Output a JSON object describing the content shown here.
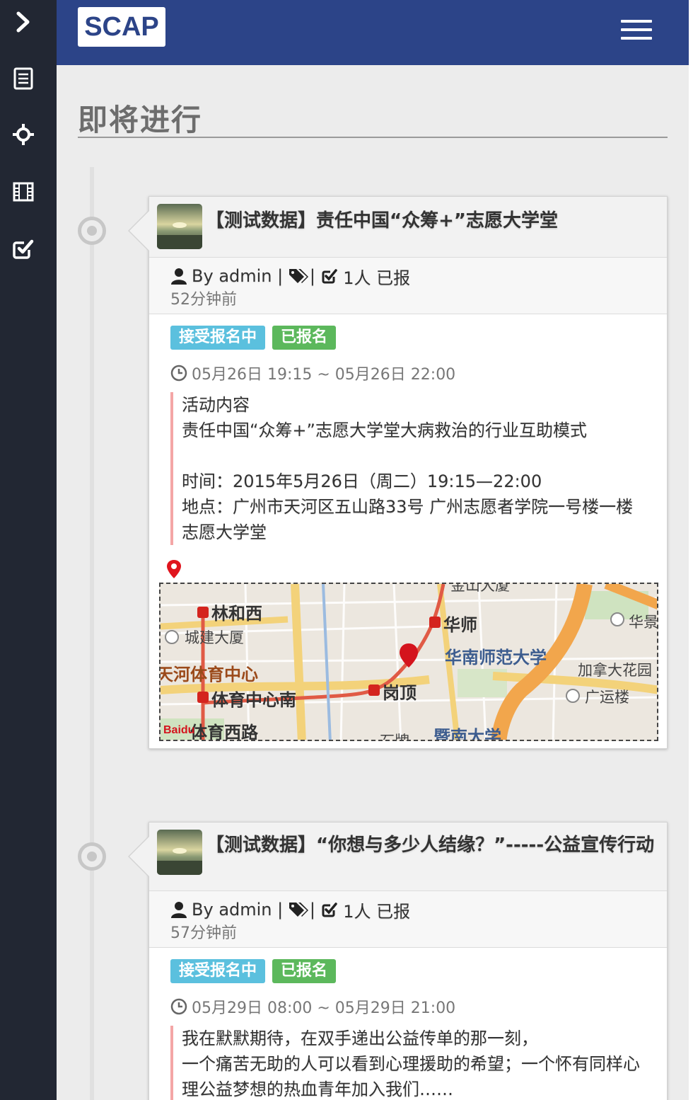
{
  "sidebar": {
    "items": [
      {
        "icon": "chevron-right-icon"
      },
      {
        "icon": "list-icon"
      },
      {
        "icon": "crosshair-icon"
      },
      {
        "icon": "film-icon"
      },
      {
        "icon": "check-square-icon"
      }
    ]
  },
  "header": {
    "logo": "SCAP",
    "menu_icon": "hamburger-icon"
  },
  "page": {
    "title": "即将进行"
  },
  "events": [
    {
      "title": "【测试数据】责任中国“众筹+”志愿大学堂",
      "author_prefix": "By",
      "author": "admin",
      "sep": "|",
      "tags_sep": "|",
      "enrolled": "1人 已报",
      "ago": "52分钟前",
      "badge_status": "接受报名中",
      "badge_joined": "已报名",
      "time_range": "05月26日 19:15 ~ 05月26日 22:00",
      "description": [
        "活动内容",
        "责任中国“众筹+”志愿大学堂大病救治的行业互助模式",
        "",
        "时间：2015年5月26日（周二）19:15—22:00",
        "地点：广州市天河区五山路33号 广州志愿者学院一号楼一楼 志愿大学堂"
      ],
      "map": {
        "labels": [
          "林和西",
          "城建大厦",
          "天河体育中心",
          "体育中心南",
          "体育西路",
          "华师",
          "华南师范大学",
          "岗顶",
          "加拿大花园",
          "广运楼",
          "华景",
          "暨南大学",
          "金山大厦",
          "石牌"
        ],
        "logo": "Baidu"
      }
    },
    {
      "title": "【测试数据】“你想与多少人结缘？”-----公益宣传行动",
      "author_prefix": "By",
      "author": "admin",
      "sep": "|",
      "tags_sep": "|",
      "enrolled": "1人 已报",
      "ago": "57分钟前",
      "badge_status": "接受报名中",
      "badge_joined": "已报名",
      "time_range": "05月29日 08:00 ~ 05月29日 21:00",
      "description": [
        "我在默默期待，在双手递出公益传单的那一刻，",
        "一个痛苦无助的人可以看到心理援助的希望；一个怀有同样心理公益梦想的热血青年加入我们……"
      ]
    }
  ],
  "colors": {
    "sidebar": "#222733",
    "header": "#2c4488",
    "badge_blue": "#5bc0de",
    "badge_green": "#5cb85c",
    "desc_border": "#f4a6a6"
  }
}
